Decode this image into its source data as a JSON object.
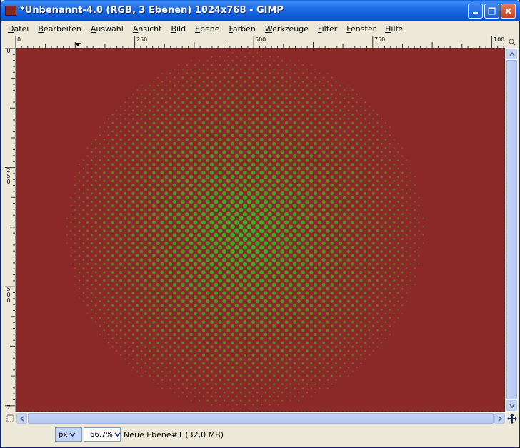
{
  "window": {
    "title": "*Unbenannt-4.0 (RGB, 3 Ebenen) 1024x768 - GIMP",
    "minimize_glyph": "▁",
    "maximize_glyph": "□",
    "close_glyph": "✕"
  },
  "menubar": {
    "items": [
      "Datei",
      "Bearbeiten",
      "Auswahl",
      "Ansicht",
      "Bild",
      "Ebene",
      "Farben",
      "Werkzeuge",
      "Filter",
      "Fenster",
      "Hilfe"
    ]
  },
  "rulers": {
    "horizontal_labels": [
      "0",
      "250",
      "500",
      "750",
      "100"
    ],
    "vertical_labels": [
      "0",
      "250",
      "500",
      "7"
    ]
  },
  "canvas": {
    "background_color": "#8b2828",
    "pattern": "green halftone dot circle",
    "dot_color_center": "#3aa32a"
  },
  "statusbar": {
    "unit": "px",
    "zoom": "66,7%",
    "layer_info": "Neue Ebene#1 (32,0 MB)"
  },
  "icons": {
    "nav": "navigate-icon",
    "quickmask": "quickmask-icon",
    "move": "move-icon"
  }
}
